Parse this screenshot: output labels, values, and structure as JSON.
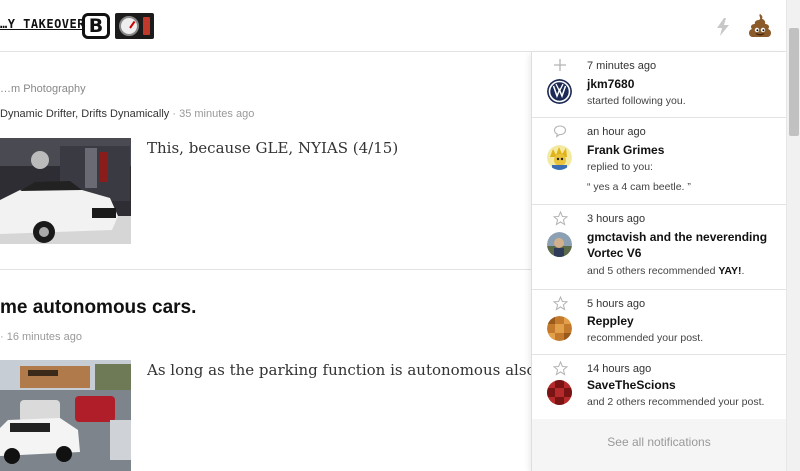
{
  "header": {
    "logo_text": "…Y TAKEOVER",
    "logo_letter": "B",
    "lightning_icon": "lightning-bolt-icon",
    "avatar_icon": "poop-emoji-icon"
  },
  "feed": {
    "post1": {
      "blog_name": "…m Photography",
      "author": "Dynamic Drifter, Drifts Dynamically",
      "separator": " · ",
      "time": "35 minutes ago",
      "excerpt": "This, because GLE, NYIAS (4/15)"
    },
    "post2": {
      "title": "me autonomous cars.",
      "byline": "· 16 minutes ago",
      "excerpt": "As long as the parking function is autonomous also."
    }
  },
  "notifications": {
    "items": [
      {
        "type_icon": "plus-icon",
        "time": "7 minutes ago",
        "name": "jkm7680",
        "action": "started following you.",
        "avatar": "vw-logo-avatar"
      },
      {
        "type_icon": "comment-bubble-icon",
        "time": "an hour ago",
        "name": "Frank Grimes",
        "action": "replied to you:",
        "quote": "“ yes a 4 cam beetle. ”",
        "avatar": "cartoon-avatar"
      },
      {
        "type_icon": "star-icon",
        "time": "3 hours ago",
        "name": "gmctavish and the neverending Vortec V6",
        "action_prefix": "and 5 others recommended ",
        "action_bold": "YAY!",
        "action_suffix": ".",
        "avatar": "photo-avatar"
      },
      {
        "type_icon": "star-icon",
        "time": "5 hours ago",
        "name": "Repp­ley",
        "action": "recommended your post.",
        "avatar": "pixel-avatar-orange"
      },
      {
        "type_icon": "star-icon",
        "time": "14 hours ago",
        "name": "SaveTheScions",
        "action": "and 2 others recommended your post.",
        "avatar": "pixel-avatar-red"
      }
    ],
    "see_all_label": "See all notifications"
  }
}
